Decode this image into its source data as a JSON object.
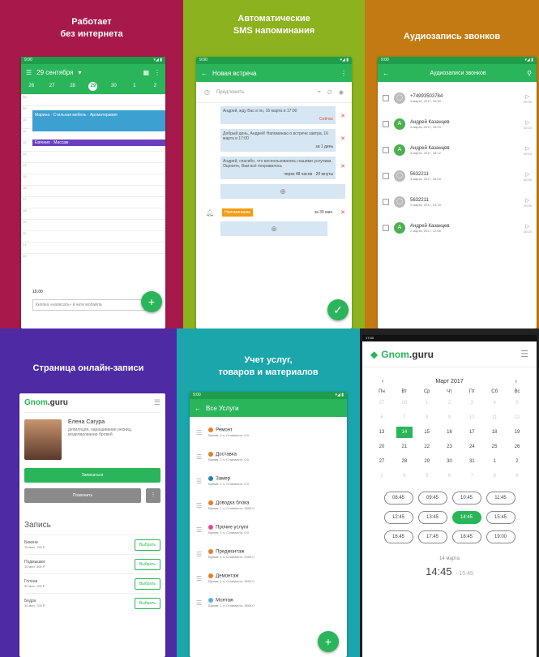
{
  "panels": {
    "offline": {
      "title1": "Работает",
      "title2": "без интернета",
      "date": "29 сентября",
      "week_nums": [
        "26",
        "27",
        "28",
        "29",
        "30",
        "1",
        "2"
      ],
      "event1": "Марина · Стильная мебель · Ароматерапия",
      "event2": "Евгения · Массаж",
      "hours": [
        "08",
        "09",
        "10",
        "11",
        "12",
        "13",
        "14",
        "15",
        "16",
        "17",
        "18",
        "19",
        "20",
        "21",
        "22"
      ],
      "bottom_time": "15:00",
      "bottom_text": "Кнопка «написать» в чате мобайла"
    },
    "sms": {
      "title1": "Автоматические",
      "title2": "SMS напоминания",
      "appbar": "Новая встреча",
      "search": "Предложить",
      "msgs": [
        {
          "text": "Андрей, жду Вас в пн, 16 марта в 17:00",
          "meta": "Сейчас"
        },
        {
          "text": "Добрый день, Андрей! Напоминаю о встрече завтра, 16 марта в 17:00",
          "meta": "за 1 день"
        },
        {
          "text": "Андрей, спасибо, что воспользовались нашими услугами. Оцените, Вам всё понравилось",
          "meta": "через 48 часов · 20 мнуты"
        }
      ],
      "chip": "Напоминание",
      "chip_meta": "за 30 мин"
    },
    "audio": {
      "title": "Аудиозапись звонков",
      "appbar": "Аудиозаписи звонков",
      "calls": [
        {
          "name": "+74993503784",
          "sub": "4 марта, 2017, 10:00",
          "initial": "",
          "color": "#bbbbbb",
          "dur": "00:35"
        },
        {
          "name": "Андрей Казанцев",
          "sub": "4 марта, 2017, 15:03",
          "initial": "А",
          "color": "#4caf50",
          "dur": "00:15"
        },
        {
          "name": "Андрей Казанцев",
          "sub": "3 марта, 2017, 18:12",
          "initial": "А",
          "color": "#4caf50",
          "dur": "00:14"
        },
        {
          "name": "5632211",
          "sub": "3 марта, 2017, 16:00",
          "initial": "",
          "color": "#bbbbbb",
          "dur": "00:30"
        },
        {
          "name": "5632211",
          "sub": "2 марта, 2017, 14:10",
          "initial": "",
          "color": "#bbbbbb",
          "dur": "00:05"
        },
        {
          "name": "Андрей Казанцев",
          "sub": "2 марта, 2017, 12:55",
          "initial": "А",
          "color": "#4caf50",
          "dur": "00:24"
        }
      ]
    },
    "booking": {
      "title": "Страница онлайн-записи",
      "logo1": "Gnom",
      "logo2": ".guru",
      "name": "Елена Сагура",
      "desc": "депиляция, наращивание ресниц, моделирование бровей",
      "btn1": "Записаться",
      "btn2": "Позвонить",
      "section": "Запись",
      "items": [
        {
          "name": "Бикини",
          "meta": "15 мин, 700 Р",
          "btn": "Выбрать"
        },
        {
          "name": "Подмышки",
          "meta": "15 мин, 300 Р",
          "btn": "Выбрать"
        },
        {
          "name": "Голени",
          "meta": "30 мин, 700 Р",
          "btn": "Выбрать"
        },
        {
          "name": "Бедра",
          "meta": "30 мин, 700 Р",
          "btn": "Выбрать"
        }
      ]
    },
    "services": {
      "title1": "Учет услуг,",
      "title2": "товаров и материалов",
      "appbar": "Все Услуги",
      "items": [
        {
          "name": "Ремонт",
          "meta": "Время: 1 ч, Стоимость: 0.0",
          "color": "#e67e22"
        },
        {
          "name": "Доставка",
          "meta": "Время: 1 ч, Стоимость: 0.0",
          "color": "#e67e22"
        },
        {
          "name": "Замер",
          "meta": "Время: 1 ч, Стоимость: 0.0",
          "color": "#2980b9"
        },
        {
          "name": "Доводка блока",
          "meta": "Время: 1 ч, Стоимость: 1500.0",
          "color": "#e67e22"
        },
        {
          "name": "Прочие услуги",
          "meta": "Время: 1 ч, Стоимость: 0.0",
          "color": "#e74c8c"
        },
        {
          "name": "Предмонтаж",
          "meta": "Время: 1 ч, Стоимость: 2000.0",
          "color": "#e67e22"
        },
        {
          "name": "Демонтаж",
          "meta": "Время: 1 ч, Стоимость: 1600.0",
          "color": "#e67e22"
        },
        {
          "name": "Монтаж",
          "meta": "Время: 1 ч, Стоимость: 3000.0",
          "color": "#5dade2"
        }
      ]
    },
    "calendar": {
      "logo1": "Gnom",
      "logo2": ".guru",
      "month": "Март 2017",
      "weekdays": [
        "Пн",
        "Вт",
        "Ср",
        "Чт",
        "Пт",
        "Сб",
        "Вс"
      ],
      "weeks": [
        [
          "27",
          "28",
          "1",
          "2",
          "3",
          "4",
          "5"
        ],
        [
          "6",
          "7",
          "8",
          "9",
          "10",
          "11",
          "12"
        ],
        [
          "13",
          "14",
          "15",
          "16",
          "17",
          "18",
          "19"
        ],
        [
          "20",
          "21",
          "22",
          "23",
          "24",
          "25",
          "26"
        ],
        [
          "27",
          "28",
          "29",
          "30",
          "31",
          "1",
          "2"
        ],
        [
          "3",
          "4",
          "5",
          "6",
          "7",
          "8",
          "9"
        ]
      ],
      "selected": "14",
      "slots": [
        "08:45",
        "09:45",
        "10:45",
        "11:45",
        "12:45",
        "13:45",
        "14:45",
        "15:45",
        "16:45",
        "17:45",
        "18:45",
        "19:00"
      ],
      "active_slot": "14:45",
      "date_label": "14 марта",
      "time_from": "14:45",
      "time_to": "15:45"
    }
  }
}
